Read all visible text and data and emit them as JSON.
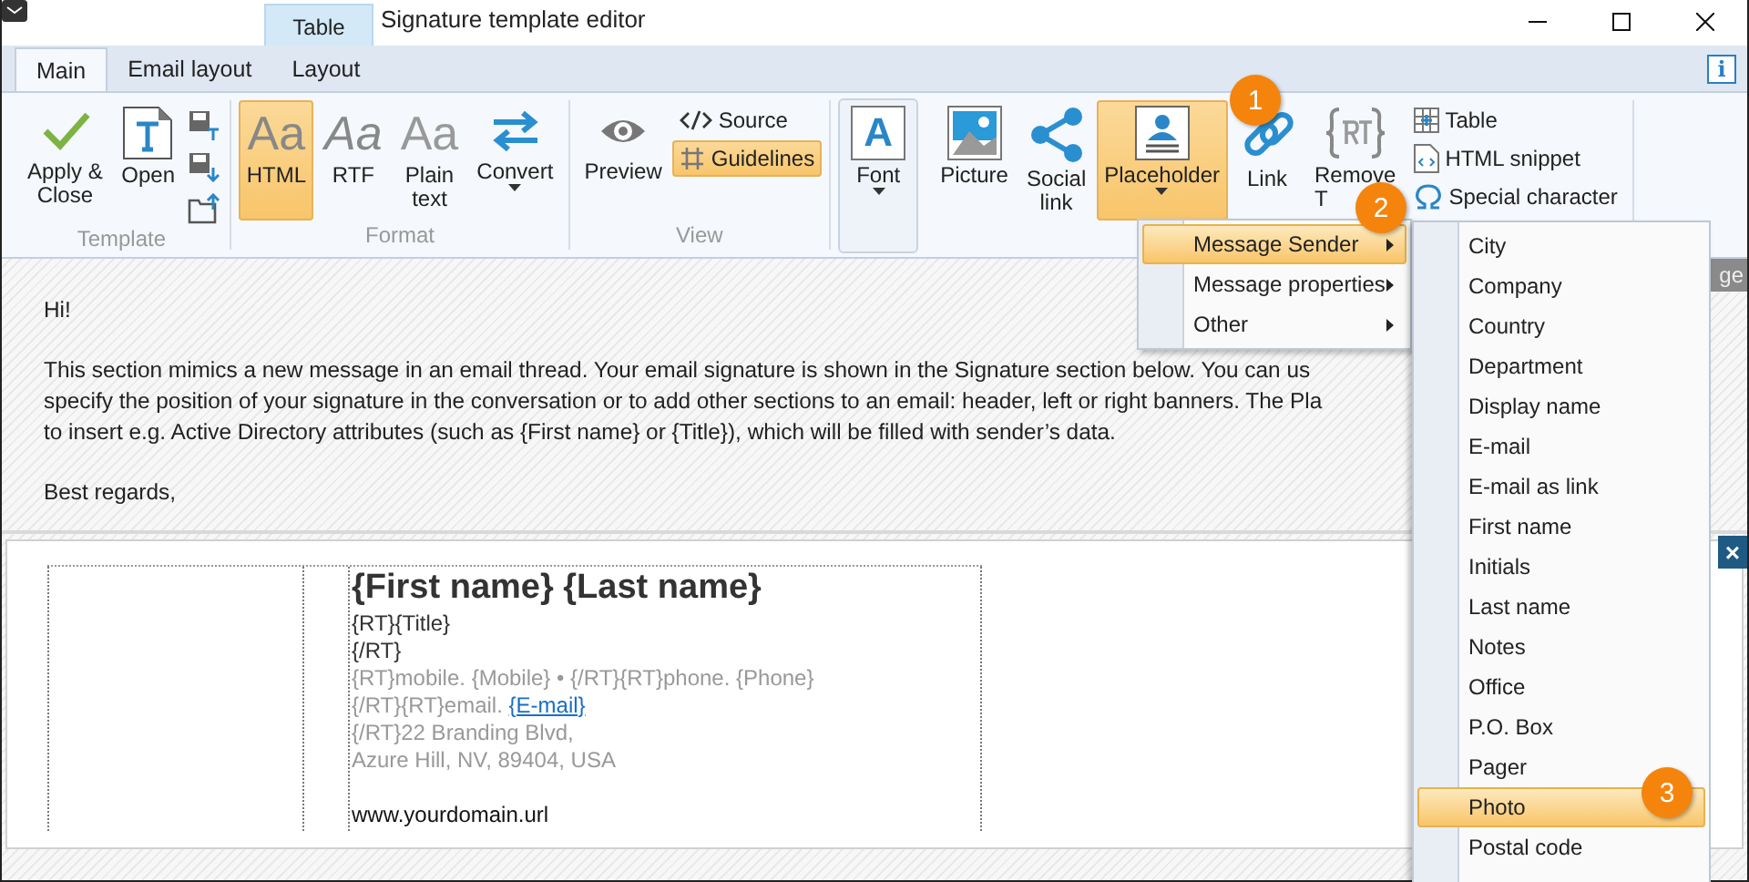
{
  "window": {
    "title": "Signature template editor",
    "context_tab": "Table"
  },
  "tabs": [
    {
      "label": "Main",
      "selected": true
    },
    {
      "label": "Email layout",
      "selected": false
    },
    {
      "label": "Layout",
      "selected": false
    }
  ],
  "ribbon_groups": [
    {
      "label": "Template",
      "items": [
        {
          "kind": "large",
          "label": "Apply &\nClose",
          "selected": false,
          "dropdown": false
        },
        {
          "kind": "large",
          "label": "Open",
          "selected": false,
          "dropdown": false
        },
        {
          "kind": "icons"
        }
      ]
    },
    {
      "label": "Format",
      "items": [
        {
          "kind": "large",
          "glyph": "Aa",
          "label": "HTML",
          "selected": true,
          "dropdown": false
        },
        {
          "kind": "large",
          "glyph": "Aa",
          "label": "RTF",
          "selected": false,
          "dropdown": false
        },
        {
          "kind": "large",
          "glyph": "Aa",
          "label": "Plain\ntext",
          "selected": false,
          "dropdown": false
        },
        {
          "kind": "large",
          "label": "Convert",
          "selected": false,
          "dropdown": true
        }
      ]
    },
    {
      "label": "View",
      "items": [
        {
          "kind": "large",
          "label": "Preview",
          "selected": false,
          "dropdown": false
        },
        {
          "kind": "smalls",
          "entries": [
            {
              "label": "Source",
              "selected": false
            },
            {
              "label": "Guidelines",
              "selected": true
            }
          ]
        }
      ]
    },
    {
      "kind": "boxed",
      "items": [
        {
          "kind": "large",
          "glyph": "A",
          "label": "Font",
          "selected": false,
          "dropdown": true
        }
      ]
    },
    {
      "items": [
        {
          "kind": "large",
          "label": "Picture",
          "selected": false,
          "dropdown": false
        },
        {
          "kind": "large",
          "label": "Social\nlink",
          "selected": false,
          "dropdown": false
        },
        {
          "kind": "large",
          "label": "Placeholder",
          "selected": true,
          "dropdown": true
        },
        {
          "kind": "large",
          "label": "Link",
          "selected": false,
          "dropdown": false
        },
        {
          "kind": "large",
          "label": "Remove\nT",
          "selected": false,
          "dropdown": false
        },
        {
          "kind": "smalls",
          "entries": [
            {
              "label": "Table",
              "selected": false
            },
            {
              "label": "HTML snippet",
              "selected": false
            },
            {
              "label": "Special character",
              "selected": false
            }
          ]
        }
      ]
    }
  ],
  "info_button": {
    "label": "i"
  },
  "message": {
    "paragraphs": [
      [
        "Hi!"
      ],
      [
        "This section mimics a new message in an email thread. Your email signature is shown in the Signature section below. You can us",
        "specify the position of your signature in the conversation or to add other sections to an email: header, left or right banners. The Pla",
        "to insert e.g. Active Directory attributes (such as {First name} or {Title}), which will be filled with sender’s data."
      ],
      [
        "Best regards,"
      ]
    ]
  },
  "signature": {
    "lines": [
      {
        "kind": "name",
        "text": "{First name} {Last name}"
      },
      {
        "kind": "dark",
        "text": "{RT}{Title}"
      },
      {
        "kind": "dark",
        "text": "{/RT}"
      },
      {
        "kind": "grey",
        "text": "{RT}mobile. {Mobile} • {/RT}{RT}phone. {Phone}"
      },
      {
        "kind": "grey",
        "text": "{/RT}{RT}email. ",
        "link": "{E-mail}"
      },
      {
        "kind": "grey",
        "text": "{/RT}22 Branding Blvd,"
      },
      {
        "kind": "grey",
        "text": "Azure Hill, NV, 89404, USA"
      },
      {
        "kind": "url",
        "text": "www.yourdomain.url"
      }
    ]
  },
  "side_tab": {
    "label": "ge"
  },
  "side_close": {
    "label": "×"
  },
  "placeholder_menu": {
    "items": [
      {
        "label": "Message Sender",
        "selected": true
      },
      {
        "label": "Message properties",
        "selected": false
      },
      {
        "label": "Other",
        "selected": false
      }
    ]
  },
  "sender_submenu": {
    "items": [
      {
        "label": "City",
        "selected": false
      },
      {
        "label": "Company",
        "selected": false
      },
      {
        "label": "Country",
        "selected": false
      },
      {
        "label": "Department",
        "selected": false
      },
      {
        "label": "Display name",
        "selected": false
      },
      {
        "label": "E-mail",
        "selected": false
      },
      {
        "label": "E-mail as link",
        "selected": false
      },
      {
        "label": "First name",
        "selected": false
      },
      {
        "label": "Initials",
        "selected": false
      },
      {
        "label": "Last name",
        "selected": false
      },
      {
        "label": "Notes",
        "selected": false
      },
      {
        "label": "Office",
        "selected": false
      },
      {
        "label": "P.O. Box",
        "selected": false
      },
      {
        "label": "Pager",
        "selected": false
      },
      {
        "label": "Photo",
        "selected": true
      },
      {
        "label": "Postal code",
        "selected": false
      }
    ]
  },
  "callouts": [
    {
      "label": "1"
    },
    {
      "label": "2"
    },
    {
      "label": "3"
    }
  ]
}
